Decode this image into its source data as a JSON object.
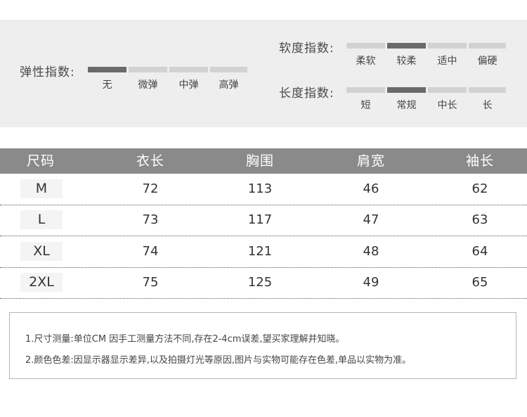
{
  "indices": {
    "elasticity": {
      "label": "弹性指数:",
      "options": [
        "无",
        "微弹",
        "中弹",
        "高弹"
      ],
      "selected": 0
    },
    "softness": {
      "label": "软度指数:",
      "options": [
        "柔软",
        "较柔",
        "适中",
        "偏硬"
      ],
      "selected": 1
    },
    "length": {
      "label": "长度指数:",
      "options": [
        "短",
        "常规",
        "中长",
        "长"
      ],
      "selected": 1
    }
  },
  "table": {
    "headers": [
      "尺码",
      "衣长",
      "胸围",
      "肩宽",
      "袖长"
    ],
    "rows": [
      [
        "M",
        "72",
        "113",
        "46",
        "62"
      ],
      [
        "L",
        "73",
        "117",
        "47",
        "63"
      ],
      [
        "XL",
        "74",
        "121",
        "48",
        "64"
      ],
      [
        "2XL",
        "75",
        "125",
        "49",
        "65"
      ]
    ]
  },
  "notes": [
    "1.尺寸测量:单位CM 因手工测量方法不同,存在2-4cm误差,望买家理解并知晓。",
    "2.颜色色差:因显示器显示差异,以及拍摄灯光等原因,图片与实物可能存在色差,单品以实物为准。"
  ],
  "colors": {
    "panel_bg": "#eeeeee",
    "segment_on": "#6a6a6a",
    "segment_off": "#d2d2d2",
    "header_bg": "#8a8a8a"
  }
}
